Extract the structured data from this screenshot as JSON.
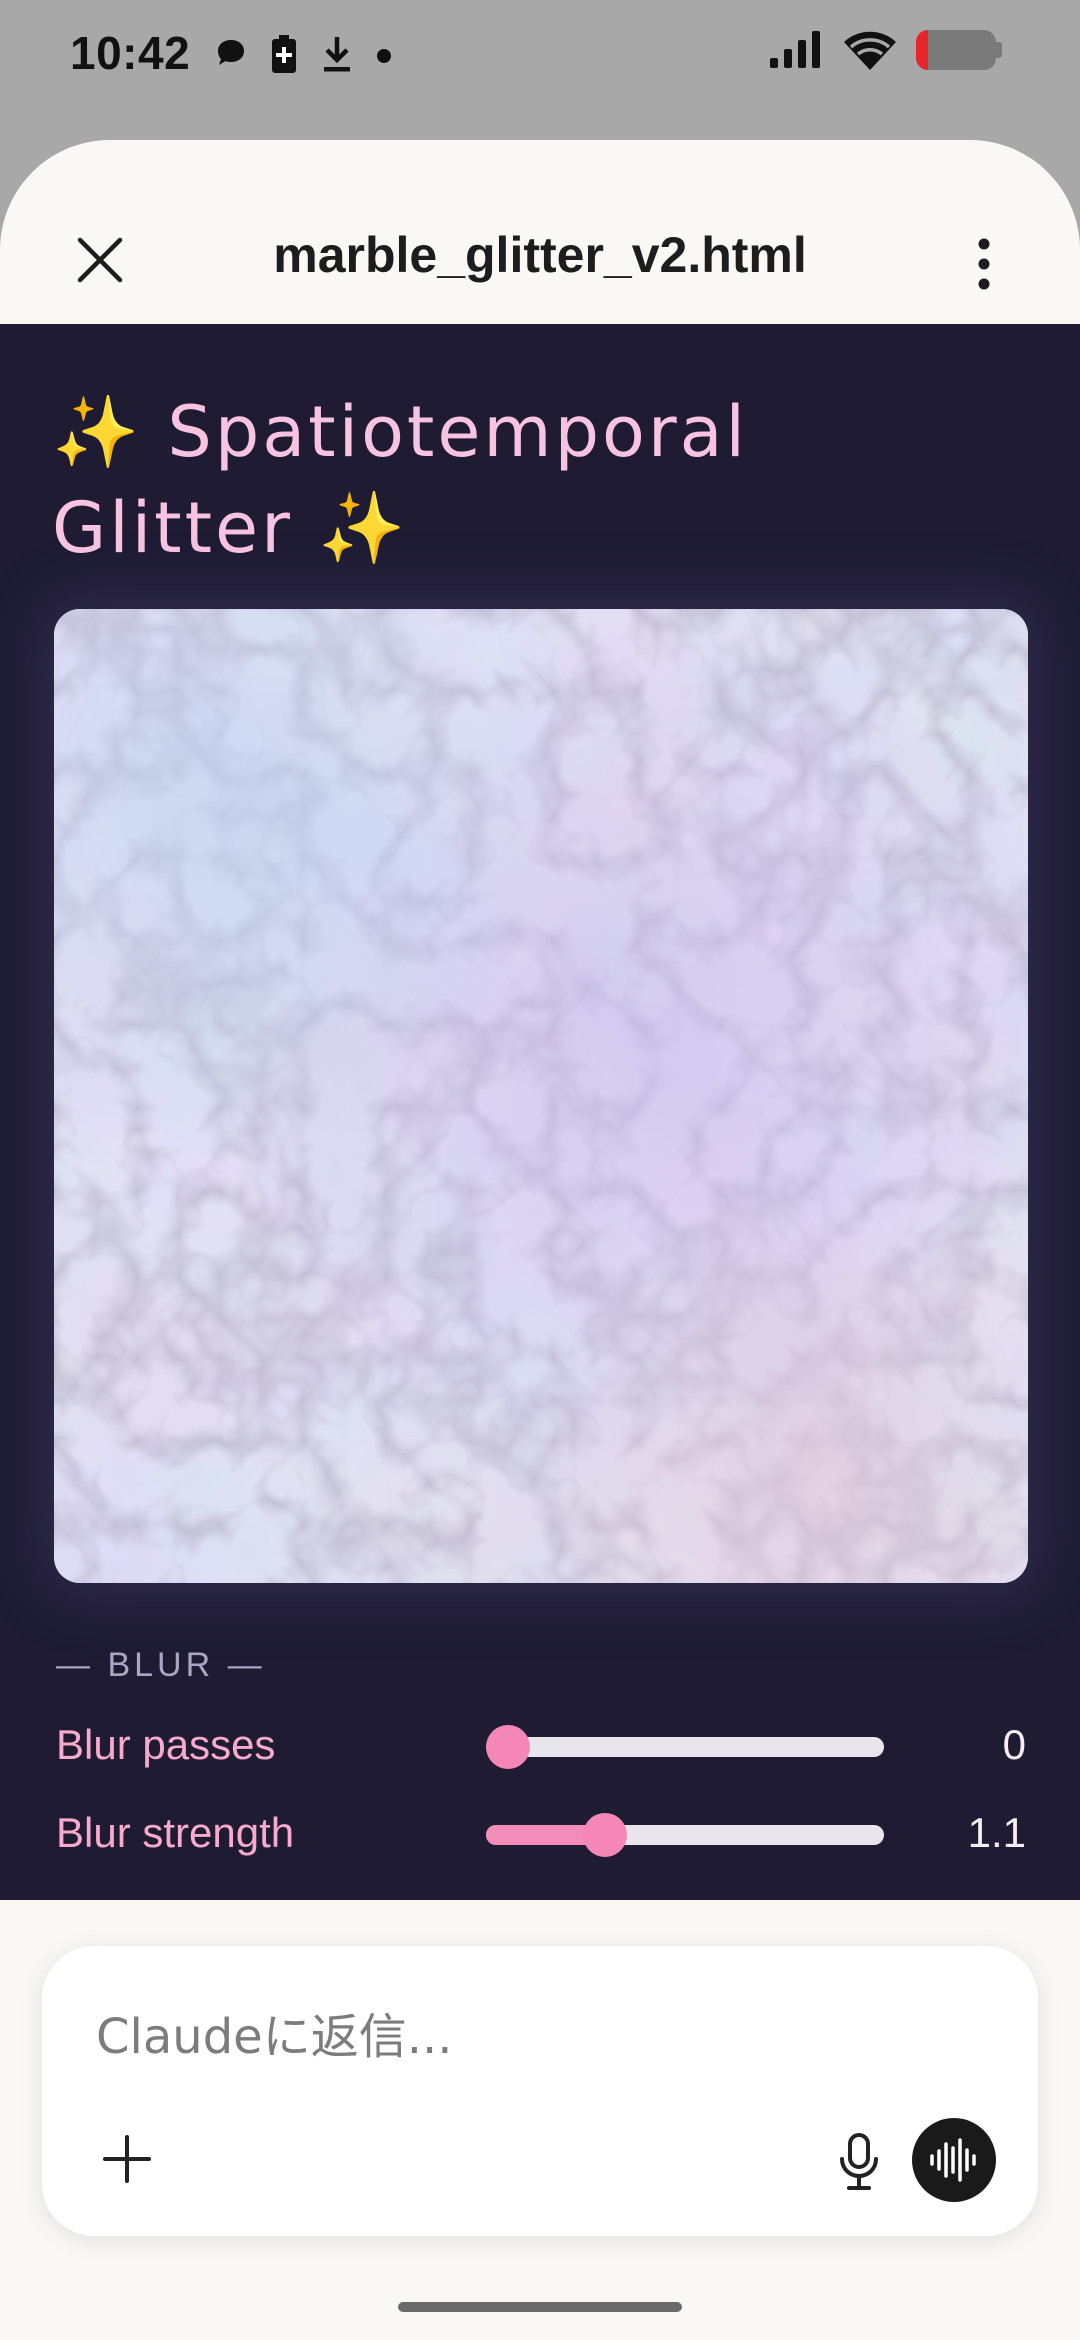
{
  "status_bar": {
    "time": "10:42",
    "left_icons": [
      "chat-bubble-icon",
      "battery-saver-icon",
      "download-icon",
      "dot-icon"
    ],
    "right_icons": [
      "signal-icon",
      "wifi-icon",
      "battery-icon"
    ],
    "battery_level": 0.15,
    "battery_color": "#e8262a"
  },
  "sheet": {
    "title": "marble_glitter_v2.html",
    "close_icon": "close-icon",
    "more_icon": "more-vert-icon"
  },
  "artifact": {
    "title": "✨ Spatiotemporal Glitter ✨",
    "background": "#1e1b33",
    "accent": "#f48cba",
    "section_label": "— BLUR —",
    "sliders": [
      {
        "label": "Blur passes",
        "value": "0",
        "fraction": 0.0
      },
      {
        "label": "Blur strength",
        "value": "1.1",
        "fraction": 0.3
      }
    ]
  },
  "composer": {
    "placeholder": "Claudeに返信...",
    "add_icon": "plus-icon",
    "mic_icon": "mic-icon",
    "voice_icon": "voice-waveform-icon"
  }
}
